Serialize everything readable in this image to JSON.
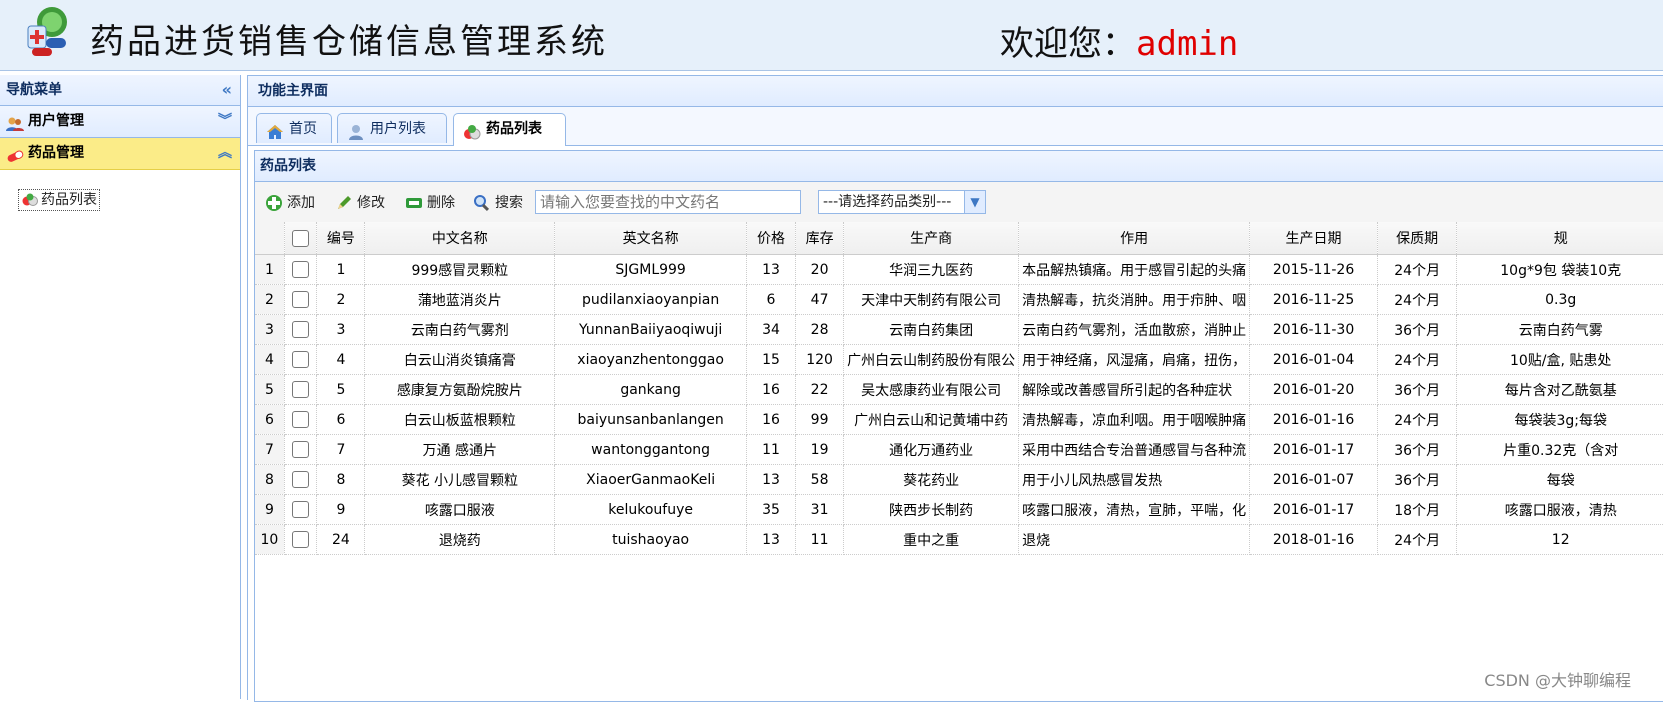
{
  "header": {
    "title": "药品进货销售仓储信息管理系统",
    "welcome_prefix": "欢迎您：",
    "username": "admin"
  },
  "sidebar": {
    "title": "导航菜单",
    "collapse_icon": "double-chevron-left",
    "sections": [
      {
        "label": "用户管理",
        "icon": "users-icon",
        "toggle": "expand"
      },
      {
        "label": "药品管理",
        "icon": "pill-icon",
        "toggle": "collapse",
        "selected": true
      }
    ],
    "items": [
      {
        "label": "药品列表",
        "icon": "pill-icon"
      }
    ]
  },
  "main": {
    "title": "功能主界面",
    "tabs": [
      {
        "label": "首页",
        "icon": "home-icon",
        "closable": false
      },
      {
        "label": "用户列表",
        "icon": "user-icon",
        "closable": true
      },
      {
        "label": "药品列表",
        "icon": "pill-icon",
        "closable": true,
        "active": true
      }
    ],
    "close_glyph": "×",
    "list_title": "药品列表"
  },
  "toolbar": {
    "add": "添加",
    "edit": "修改",
    "delete": "删除",
    "search": "搜索",
    "search_placeholder": "请输入您要查找的中文药名",
    "category_value": "---请选择药品类别---"
  },
  "grid": {
    "columns": [
      "编号",
      "中文名称",
      "英文名称",
      "价格",
      "库存",
      "生产商",
      "作用",
      "生产日期",
      "保质期",
      "规"
    ],
    "rows": [
      {
        "rn": "1",
        "id": "1",
        "cn": "999感冒灵颗粒",
        "en": "SJGML999",
        "price": "13",
        "stock": "20",
        "maker": "华润三九医药",
        "effect": "本品解热镇痛。用于感冒引起的头痛",
        "date": "2015-11-26",
        "shelf": "24个月",
        "spec": "10g*9包 袋装10克"
      },
      {
        "rn": "2",
        "id": "2",
        "cn": "蒲地蓝消炎片",
        "en": "pudilanxiaoyanpian",
        "price": "6",
        "stock": "47",
        "maker": "天津中天制药有限公司",
        "effect": "清热解毒，抗炎消肿。用于疖肿、咽",
        "date": "2016-11-25",
        "shelf": "24个月",
        "spec": "0.3g"
      },
      {
        "rn": "3",
        "id": "3",
        "cn": "云南白药气雾剂",
        "en": "YunnanBaiiyaoqiwuji",
        "price": "34",
        "stock": "28",
        "maker": "云南白药集团",
        "effect": "云南白药气雾剂，活血散瘀，消肿止",
        "date": "2016-11-30",
        "shelf": "36个月",
        "spec": "云南白药气雾"
      },
      {
        "rn": "4",
        "id": "4",
        "cn": "白云山消炎镇痛膏",
        "en": "xiaoyanzhentonggao",
        "price": "15",
        "stock": "120",
        "maker": "广州白云山制药股份有限公",
        "effect": "用于神经痛，风湿痛，肩痛，扭伤，",
        "date": "2016-01-04",
        "shelf": "24个月",
        "spec": "10贴/盒, 贴患处"
      },
      {
        "rn": "5",
        "id": "5",
        "cn": "感康复方氨酚烷胺片",
        "en": "gankang",
        "price": "16",
        "stock": "22",
        "maker": "吴太感康药业有限公司",
        "effect": "解除或改善感冒所引起的各种症状",
        "date": "2016-01-20",
        "shelf": "36个月",
        "spec": "每片含对乙酰氨基"
      },
      {
        "rn": "6",
        "id": "6",
        "cn": "白云山板蓝根颗粒",
        "en": "baiyunsanbanlangen",
        "price": "16",
        "stock": "99",
        "maker": "广州白云山和记黄埔中药",
        "effect": "清热解毒，凉血利咽。用于咽喉肿痛",
        "date": "2016-01-16",
        "shelf": "24个月",
        "spec": "每袋装3g;每袋"
      },
      {
        "rn": "7",
        "id": "7",
        "cn": "万通 感通片",
        "en": "wantonggantong",
        "price": "11",
        "stock": "19",
        "maker": "通化万通药业",
        "effect": "采用中西结合专治普通感冒与各种流",
        "date": "2016-01-17",
        "shelf": "36个月",
        "spec": "片重0.32克（含对"
      },
      {
        "rn": "8",
        "id": "8",
        "cn": "葵花 小儿感冒颗粒",
        "en": "XiaoerGanmaoKeli",
        "price": "13",
        "stock": "58",
        "maker": "葵花药业",
        "effect": "用于小儿风热感冒发热",
        "date": "2016-01-07",
        "shelf": "36个月",
        "spec": "每袋"
      },
      {
        "rn": "9",
        "id": "9",
        "cn": "咳露口服液",
        "en": "kelukoufuye",
        "price": "35",
        "stock": "31",
        "maker": "陕西步长制药",
        "effect": "咳露口服液，清热，宣肺，平喘，化",
        "date": "2016-01-17",
        "shelf": "18个月",
        "spec": "咳露口服液，清热"
      },
      {
        "rn": "10",
        "id": "24",
        "cn": "退烧药",
        "en": "tuishaoyao",
        "price": "13",
        "stock": "11",
        "maker": "重中之重",
        "effect": "退烧",
        "date": "2018-01-16",
        "shelf": "24个月",
        "spec": "12"
      }
    ]
  },
  "watermark": "CSDN @大钟聊编程"
}
